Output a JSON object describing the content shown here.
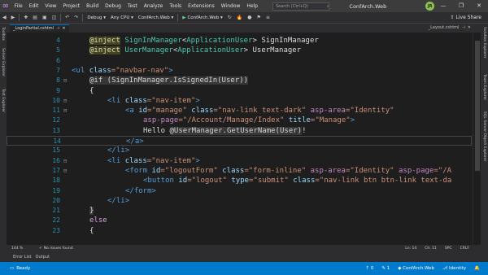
{
  "titlebar": {
    "menu": [
      "File",
      "Edit",
      "View",
      "Project",
      "Build",
      "Debug",
      "Test",
      "Analyze",
      "Tools",
      "Extensions",
      "Window",
      "Help"
    ],
    "search_placeholder": "Search (Ctrl+Q)",
    "search_icon": "search-icon",
    "project_title": "ConfArch.Web",
    "account_initials": "JR",
    "controls": [
      "—",
      "❐",
      "✕"
    ]
  },
  "toolbar": {
    "config": "Debug",
    "platform": "Any CPU",
    "startup_project": "ConfArch.Web",
    "run_target": "ConfArch.Web",
    "live_share": "Live Share"
  },
  "side_tabs": {
    "left": [
      "Toolbox",
      "Server Explorer",
      "Test Explorer"
    ],
    "right": [
      "Solution Explorer",
      "Team Explorer",
      "SQL Server Object Explorer"
    ]
  },
  "doc_tabs": {
    "left": "_LoginPartial.cshtml",
    "right": "_Layout.cshtml"
  },
  "code": {
    "lines": [
      {
        "n": "4",
        "fold": "",
        "indent": 1,
        "segments": [
          [
            "@inject",
            "raz"
          ],
          [
            " ",
            "txt"
          ],
          [
            "SignInManager",
            "type"
          ],
          [
            "<",
            "txt"
          ],
          [
            "ApplicationUser",
            "type"
          ],
          [
            "> SignInManager",
            "txt"
          ]
        ]
      },
      {
        "n": "5",
        "fold": "",
        "indent": 1,
        "segments": [
          [
            "@inject",
            "raz"
          ],
          [
            " ",
            "txt"
          ],
          [
            "UserManager",
            "type"
          ],
          [
            "<",
            "txt"
          ],
          [
            "ApplicationUser",
            "type"
          ],
          [
            "> UserManager",
            "txt"
          ]
        ]
      },
      {
        "n": "6",
        "fold": "",
        "indent": 0,
        "segments": []
      },
      {
        "n": "7",
        "fold": "",
        "indent": 0,
        "segments": [
          [
            "<",
            "tag"
          ],
          [
            "ul",
            "tag"
          ],
          [
            " ",
            "txt"
          ],
          [
            "class",
            "attr"
          ],
          [
            "=\"navbar-nav\"",
            "val"
          ],
          [
            ">",
            "tag"
          ]
        ]
      },
      {
        "n": "8",
        "fold": "⊟",
        "indent": 1,
        "segments": [
          [
            "@if (SignInManager.IsSignedIn(User))",
            "razb"
          ]
        ]
      },
      {
        "n": "9",
        "fold": "",
        "indent": 1,
        "segments": [
          [
            "{",
            "txt"
          ]
        ]
      },
      {
        "n": "10",
        "fold": "⊟",
        "indent": 2,
        "segments": [
          [
            "<",
            "tag"
          ],
          [
            "li",
            "tag"
          ],
          [
            " ",
            "txt"
          ],
          [
            "class",
            "attr"
          ],
          [
            "=\"nav-item\"",
            "val"
          ],
          [
            ">",
            "tag"
          ]
        ]
      },
      {
        "n": "11",
        "fold": "⊟",
        "indent": 3,
        "segments": [
          [
            "<",
            "tag"
          ],
          [
            "a",
            "tag"
          ],
          [
            " ",
            "txt"
          ],
          [
            "id",
            "attr"
          ],
          [
            "=\"manage\" ",
            "val"
          ],
          [
            "class",
            "attr"
          ],
          [
            "=\"nav-link text-dark\" ",
            "val"
          ],
          [
            "asp-area",
            "attrpurple"
          ],
          [
            "=\"Identity\"",
            "val"
          ]
        ]
      },
      {
        "n": "12",
        "fold": "",
        "indent": 4,
        "segments": [
          [
            "asp-page",
            "attrpurple"
          ],
          [
            "=\"/Account/Manage/Index\" ",
            "val"
          ],
          [
            "title",
            "attr"
          ],
          [
            "=\"Manage\"",
            "val"
          ],
          [
            ">",
            "tag"
          ]
        ]
      },
      {
        "n": "13",
        "fold": "",
        "indent": 4,
        "segments": [
          [
            "Hello ",
            "txt"
          ],
          [
            "@UserManager.GetUserName(User)",
            "razb"
          ],
          [
            "!",
            "txt"
          ]
        ]
      },
      {
        "n": "14",
        "fold": "",
        "indent": 3,
        "segments": [
          [
            "</",
            "tag"
          ],
          [
            "a",
            "tag"
          ],
          [
            ">",
            "tag"
          ]
        ]
      },
      {
        "n": "15",
        "fold": "",
        "indent": 2,
        "segments": [
          [
            "</",
            "tag"
          ],
          [
            "li",
            "tag"
          ],
          [
            ">",
            "tag"
          ]
        ]
      },
      {
        "n": "16",
        "fold": "⊟",
        "indent": 2,
        "segments": [
          [
            "<",
            "tag"
          ],
          [
            "li",
            "tag"
          ],
          [
            " ",
            "txt"
          ],
          [
            "class",
            "attr"
          ],
          [
            "=\"nav-item\"",
            "val"
          ],
          [
            ">",
            "tag"
          ]
        ]
      },
      {
        "n": "17",
        "fold": "⊟",
        "indent": 3,
        "segments": [
          [
            "<",
            "tag"
          ],
          [
            "form",
            "tag"
          ],
          [
            " ",
            "txt"
          ],
          [
            "id",
            "attr"
          ],
          [
            "=\"logoutForm\" ",
            "val"
          ],
          [
            "class",
            "attr"
          ],
          [
            "=\"form-inline\" ",
            "val"
          ],
          [
            "asp-area",
            "attrpurple"
          ],
          [
            "=\"Identity\" ",
            "val"
          ],
          [
            "asp-page",
            "attrpurple"
          ],
          [
            "=\"/A",
            "val"
          ]
        ]
      },
      {
        "n": "18",
        "fold": "",
        "indent": 4,
        "segments": [
          [
            "<",
            "tag"
          ],
          [
            "button",
            "tag"
          ],
          [
            " ",
            "txt"
          ],
          [
            "id",
            "attr"
          ],
          [
            "=\"logout\" ",
            "val"
          ],
          [
            "type",
            "attr"
          ],
          [
            "=\"submit\" ",
            "val"
          ],
          [
            "class",
            "attr"
          ],
          [
            "=\"nav-link btn btn-link text-da",
            "val"
          ]
        ]
      },
      {
        "n": "19",
        "fold": "",
        "indent": 3,
        "segments": [
          [
            "</",
            "tag"
          ],
          [
            "form",
            "tag"
          ],
          [
            ">",
            "tag"
          ]
        ]
      },
      {
        "n": "20",
        "fold": "",
        "indent": 2,
        "segments": [
          [
            "</",
            "tag"
          ],
          [
            "li",
            "tag"
          ],
          [
            ">",
            "tag"
          ]
        ]
      },
      {
        "n": "21",
        "fold": "",
        "indent": 1,
        "segments": [
          [
            "}",
            "razb"
          ]
        ]
      },
      {
        "n": "22",
        "fold": "",
        "indent": 1,
        "segments": [
          [
            "else",
            "kw"
          ]
        ]
      },
      {
        "n": "23",
        "fold": "",
        "indent": 1,
        "segments": [
          [
            "{",
            "txt"
          ]
        ]
      }
    ]
  },
  "editor_status": {
    "zoom": "144 %",
    "issues": "No issues found",
    "line": "Ln: 14",
    "col": "Ch: 11",
    "mode": "SPC",
    "eol": "CRLF"
  },
  "bottom_tabs": [
    "Error List",
    "Output"
  ],
  "statusbar": {
    "ready": "Ready",
    "up_count": "0",
    "edits_count": "1",
    "project": "ConfArch.Web",
    "branch": "Identity"
  },
  "colors": {
    "accent": "#007acc",
    "editor_bg": "#1e1e1e",
    "chrome": "#2d2d30"
  }
}
